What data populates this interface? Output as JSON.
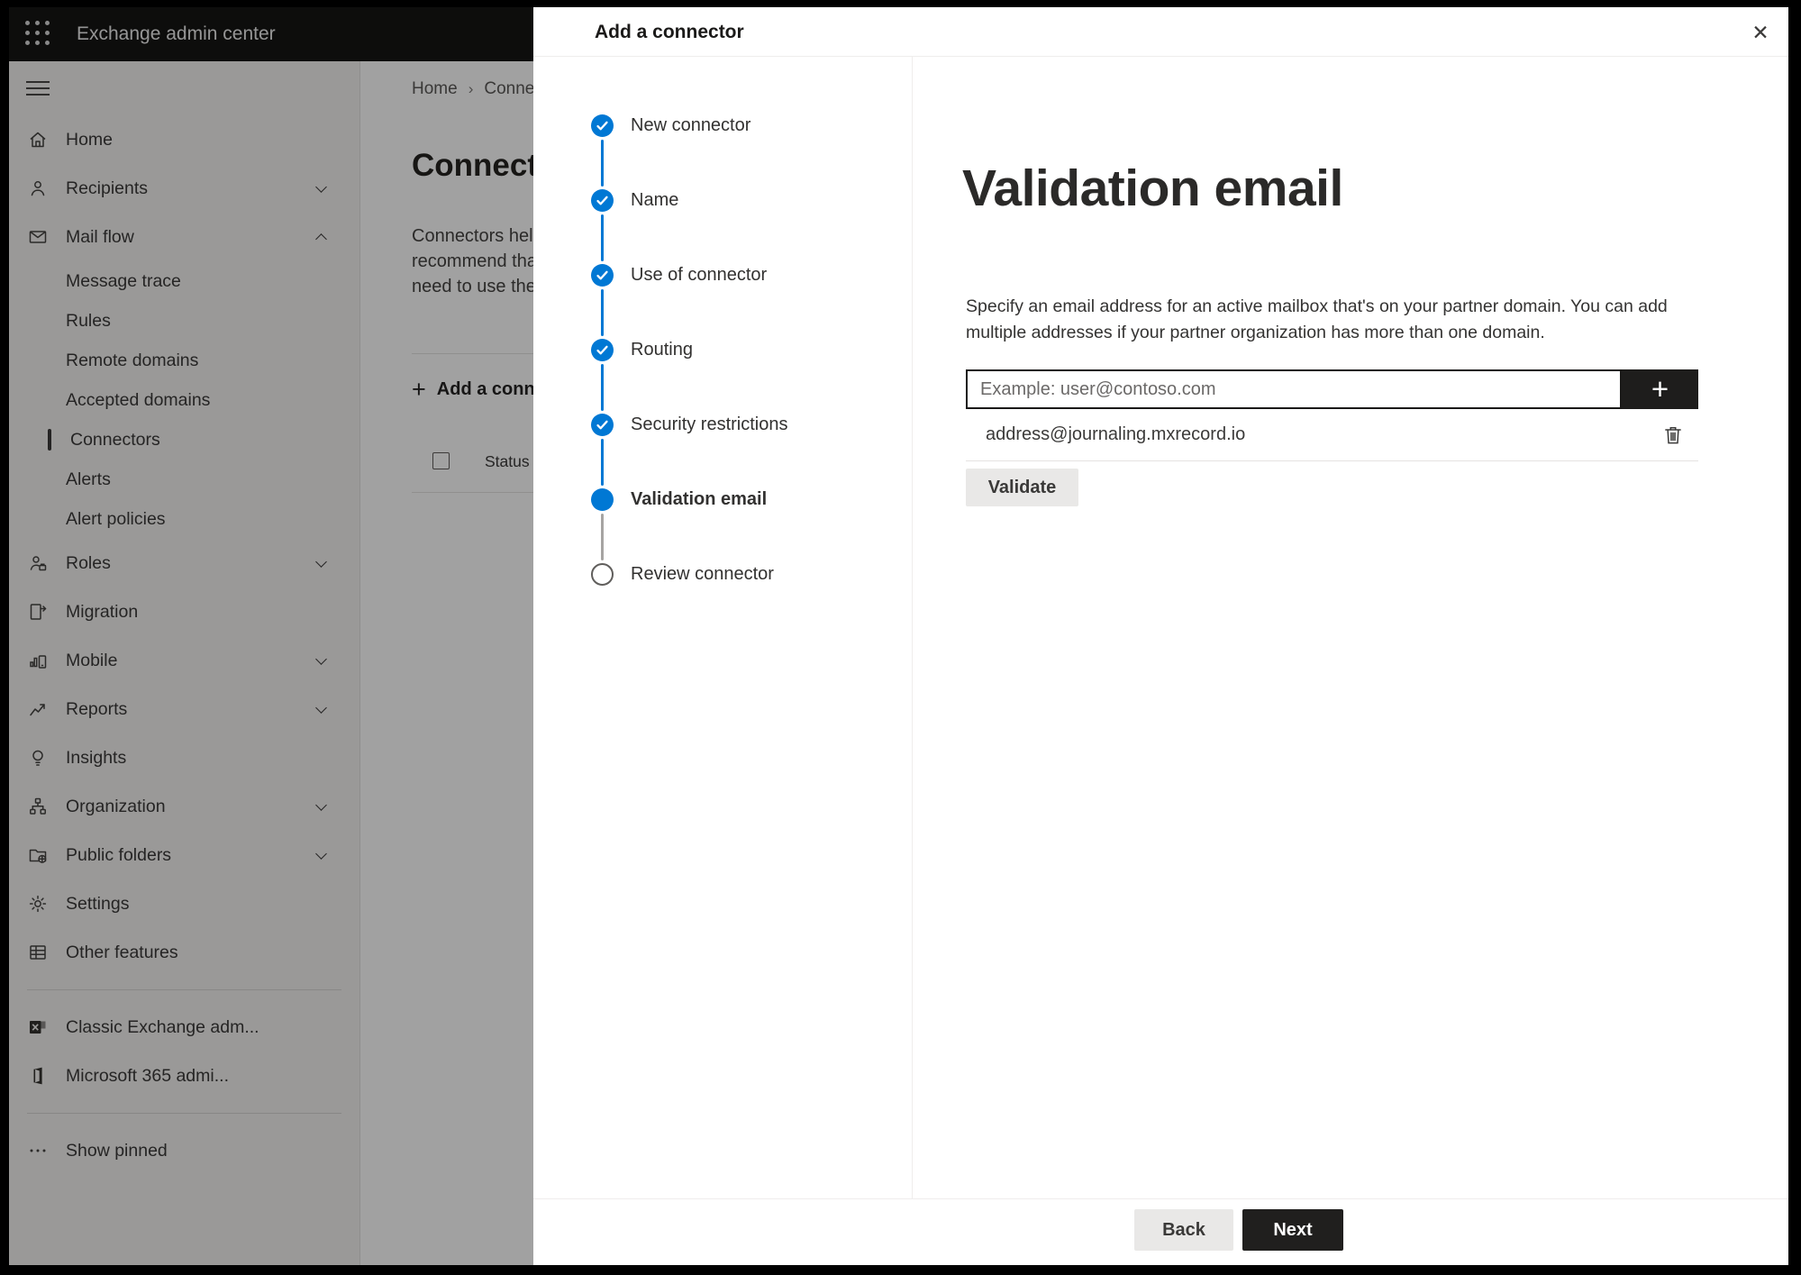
{
  "topbar": {
    "app_title": "Exchange admin center",
    "app_launcher_icon": "waffle"
  },
  "sidebar": {
    "menu_icon": "hamburger",
    "items": [
      {
        "label": "Home",
        "icon": "home",
        "cls": "top",
        "chevron": "",
        "interactable": "true"
      },
      {
        "label": "Recipients",
        "icon": "person",
        "cls": "top",
        "chevron": "chevron-down",
        "interactable": "true"
      },
      {
        "label": "Mail flow",
        "icon": "mail",
        "cls": "top",
        "chevron": "chevron-up",
        "interactable": "true"
      },
      {
        "label": "Message trace",
        "icon": "",
        "cls": "sub",
        "chevron": "",
        "interactable": "true"
      },
      {
        "label": "Rules",
        "icon": "",
        "cls": "sub",
        "chevron": "",
        "interactable": "true"
      },
      {
        "label": "Remote domains",
        "icon": "",
        "cls": "sub",
        "chevron": "",
        "interactable": "true"
      },
      {
        "label": "Accepted domains",
        "icon": "",
        "cls": "sub",
        "chevron": "",
        "interactable": "true"
      },
      {
        "label": "Connectors",
        "icon": "",
        "cls": "sub selected",
        "chevron": "",
        "interactable": "true"
      },
      {
        "label": "Alerts",
        "icon": "",
        "cls": "sub",
        "chevron": "",
        "interactable": "true"
      },
      {
        "label": "Alert policies",
        "icon": "",
        "cls": "sub",
        "chevron": "",
        "interactable": "true"
      },
      {
        "label": "Roles",
        "icon": "roles",
        "cls": "top",
        "chevron": "chevron-down",
        "interactable": "true"
      },
      {
        "label": "Migration",
        "icon": "migration",
        "cls": "top",
        "chevron": "",
        "interactable": "true"
      },
      {
        "label": "Mobile",
        "icon": "mobile",
        "cls": "top",
        "chevron": "chevron-down",
        "interactable": "true"
      },
      {
        "label": "Reports",
        "icon": "reports",
        "cls": "top",
        "chevron": "chevron-down",
        "interactable": "true"
      },
      {
        "label": "Insights",
        "icon": "insights",
        "cls": "top",
        "chevron": "",
        "interactable": "true"
      },
      {
        "label": "Organization",
        "icon": "organization",
        "cls": "top",
        "chevron": "chevron-down",
        "interactable": "true"
      },
      {
        "label": "Public folders",
        "icon": "public-folders",
        "cls": "top",
        "chevron": "chevron-down",
        "interactable": "true"
      },
      {
        "label": "Settings",
        "icon": "settings",
        "cls": "top",
        "chevron": "",
        "interactable": "true"
      },
      {
        "label": "Other features",
        "icon": "other-features",
        "cls": "top",
        "chevron": "",
        "interactable": "true"
      },
      {
        "label": "",
        "icon": "",
        "cls": "divider",
        "chevron": "",
        "interactable": "false"
      },
      {
        "label": "Classic Exchange adm...",
        "icon": "exchange-logo",
        "cls": "top",
        "chevron": "",
        "interactable": "true"
      },
      {
        "label": "Microsoft 365 admi...",
        "icon": "m365-logo",
        "cls": "top",
        "chevron": "",
        "interactable": "true"
      },
      {
        "label": "",
        "icon": "",
        "cls": "divider",
        "chevron": "",
        "interactable": "false"
      },
      {
        "label": "Show pinned",
        "icon": "ellipsis",
        "cls": "top",
        "chevron": "",
        "interactable": "true"
      }
    ]
  },
  "background_page": {
    "breadcrumb": {
      "home": "Home",
      "separator": "›",
      "current": "Connectors"
    },
    "title": "Connectors",
    "description_lines": [
      {
        "text": "Connectors help"
      },
      {
        "text": "recommend that"
      },
      {
        "text": "need to use them"
      }
    ],
    "add_button_label": "Add a connector",
    "add_icon": "plus",
    "table": {
      "status_header": "Status",
      "checkbox_checked": false
    }
  },
  "dialog": {
    "title": "Add a connector",
    "close_icon": "close-x",
    "close_glyph": "✕",
    "steps": [
      {
        "label": "New connector",
        "state": "completed",
        "line": "line-none",
        "interactable": "true"
      },
      {
        "label": "Name",
        "state": "completed",
        "line": "line-blue",
        "interactable": "true"
      },
      {
        "label": "Use of connector",
        "state": "completed",
        "line": "line-blue",
        "interactable": "true"
      },
      {
        "label": "Routing",
        "state": "completed",
        "line": "line-blue",
        "interactable": "true"
      },
      {
        "label": "Security restrictions",
        "state": "completed",
        "line": "line-blue",
        "interactable": "true"
      },
      {
        "label": "Validation email",
        "state": "current",
        "line": "line-blue",
        "interactable": "true"
      },
      {
        "label": "Review connector",
        "state": "upcoming",
        "line": "line-gray",
        "interactable": "false"
      }
    ],
    "content": {
      "heading": "Validation email",
      "description": "Specify an email address for an active mailbox that's on your partner domain. You can add multiple addresses if your partner organization has more than one domain.",
      "email_input": {
        "value": "",
        "placeholder": "Example: user@contoso.com"
      },
      "add_address_icon": "plus",
      "add_address_glyph": "+",
      "addresses": [
        {
          "email": "address@journaling.mxrecord.io",
          "delete_icon": "trash"
        }
      ],
      "validate_button": "Validate"
    },
    "footer": {
      "back_button": "Back",
      "next_button": "Next"
    }
  },
  "colors": {
    "accent_blue": "#0078d4",
    "topbar_bg": "#161514",
    "dark_button": "#1e1d1c",
    "light_button": "#e9e8e7",
    "sidebar_bg": "#f4f3f1",
    "overlay": "rgba(0,0,0,0.37)"
  }
}
